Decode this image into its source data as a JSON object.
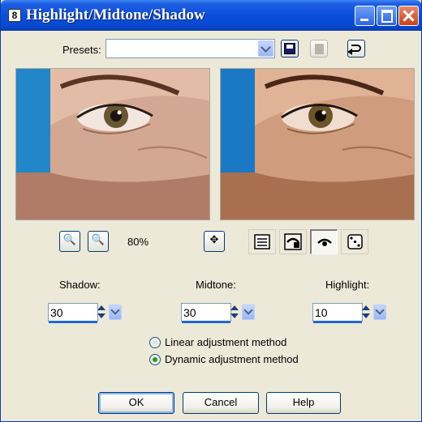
{
  "window": {
    "title": "Highlight/Midtone/Shadow",
    "app_icon_text": "8"
  },
  "presets": {
    "label": "Presets:",
    "value": ""
  },
  "zoom": {
    "level": "80%"
  },
  "fields": {
    "shadow": {
      "label": "Shadow:",
      "value": "30"
    },
    "midtone": {
      "label": "Midtone:",
      "value": "30"
    },
    "highlight": {
      "label": "Highlight:",
      "value": "10"
    }
  },
  "method": {
    "options": [
      {
        "label": "Linear adjustment method",
        "selected": false
      },
      {
        "label": "Dynamic adjustment method",
        "selected": true
      }
    ]
  },
  "buttons": {
    "ok": "OK",
    "cancel": "Cancel",
    "help": "Help"
  },
  "colors": {
    "title_bar": "#0a4edc",
    "dialog_bg": "#ece9d8",
    "checked_radio": "#21a121",
    "preview_background": "#2187c9"
  }
}
